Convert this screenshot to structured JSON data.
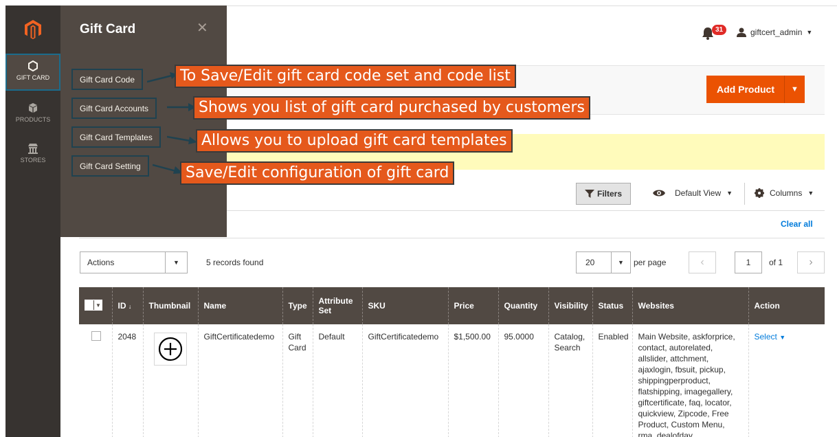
{
  "nav": {
    "items": [
      {
        "label": "GIFT CARD",
        "icon": "gift-card-hexagon-icon",
        "active": true
      },
      {
        "label": "PRODUCTS",
        "icon": "cube-icon",
        "active": false
      },
      {
        "label": "STORES",
        "icon": "store-icon",
        "active": false
      }
    ]
  },
  "panel": {
    "title": "Gift Card",
    "links": [
      {
        "label": "Gift Card Code",
        "callout": "To Save/Edit gift card code set and code list"
      },
      {
        "label": "Gift Card Accounts",
        "callout": "Shows you list of gift card purchased by customers"
      },
      {
        "label": "Gift Card Templates",
        "callout": "Allows you to upload gift card templates"
      },
      {
        "label": "Gift Card Setting",
        "callout": "Save/Edit configuration of gift card"
      }
    ]
  },
  "header": {
    "notification_count": "31",
    "username": "giftcert_admin"
  },
  "page_actions": {
    "add_product_label": "Add Product"
  },
  "toolbar": {
    "filters_label": "Filters",
    "view_label": "Default View",
    "columns_label": "Columns",
    "clear_all_label": "Clear all",
    "actions_label": "Actions",
    "records_found": "5 records found",
    "per_page_value": "20",
    "per_page_label": "per page",
    "current_page": "1",
    "page_of": "of 1"
  },
  "grid": {
    "columns": [
      "ID",
      "Thumbnail",
      "Name",
      "Type",
      "Attribute Set",
      "SKU",
      "Price",
      "Quantity",
      "Visibility",
      "Status",
      "Websites",
      "Action"
    ],
    "rows": [
      {
        "id": "2048",
        "name": "GiftCertificatedemo",
        "type": "Gift Card",
        "attribute_set": "Default",
        "sku": "GiftCertificatedemo",
        "price": "$1,500.00",
        "quantity": "95.0000",
        "visibility": "Catalog, Search",
        "status": "Enabled",
        "websites": "Main Website, askforprice, contact, autorelated, allslider, attchment, ajaxlogin, fbsuit, pickup, shippingperproduct, flatshipping, imagegallery, giftcertificate, faq, locator, quickview, Zipcode, Free Product, Custom Menu, rma, dealofday",
        "action": "Select"
      }
    ]
  },
  "colors": {
    "nav_bg": "#373330",
    "panel_bg": "#514943",
    "accent": "#eb5202",
    "callout_bg": "#e5591c",
    "link": "#007bdb",
    "notice_bg": "#fffbbb"
  }
}
